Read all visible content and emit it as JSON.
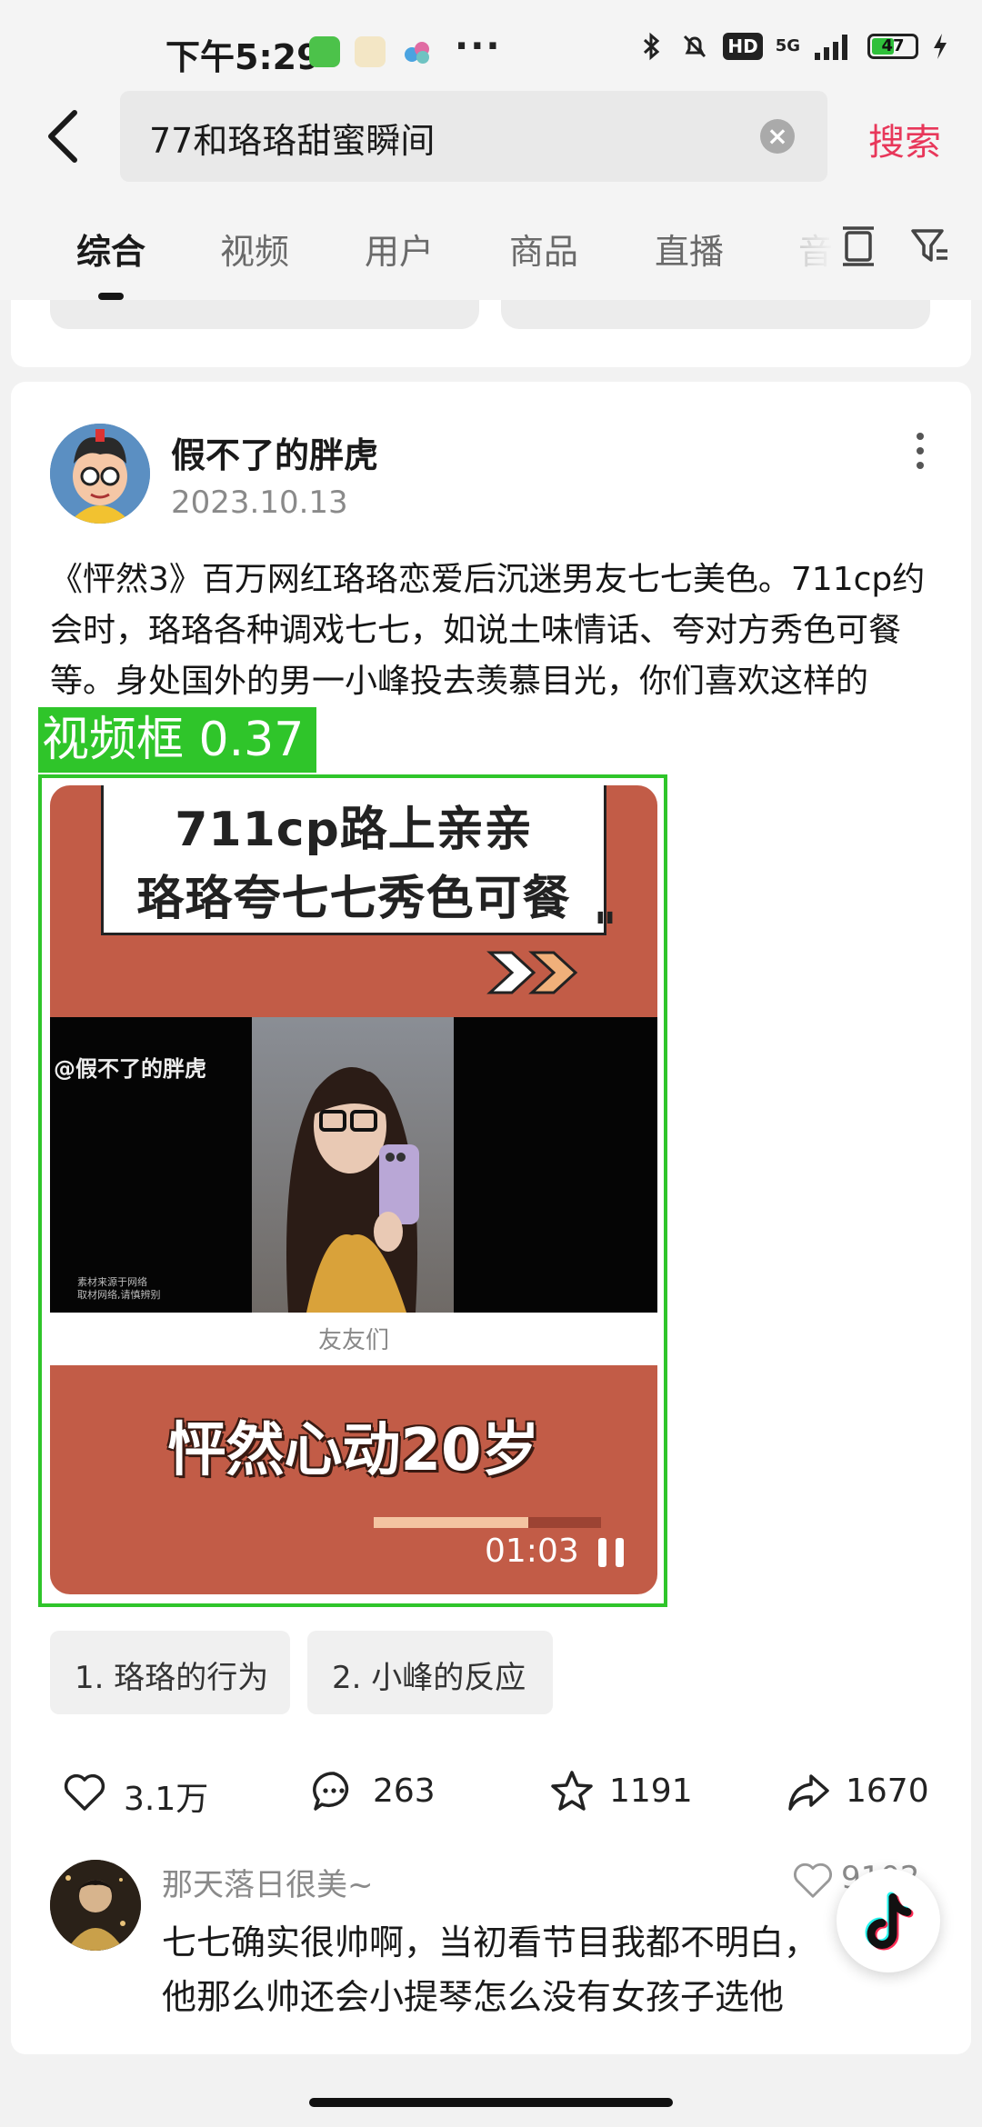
{
  "status_bar": {
    "time": "下午5:29",
    "battery": "47",
    "network": "5G",
    "hd": "HD",
    "more": "···"
  },
  "search": {
    "query": "77和珞珞甜蜜瞬间",
    "clear": "×",
    "submit": "搜索"
  },
  "tabs": [
    {
      "label": "综合",
      "active": true
    },
    {
      "label": "视频"
    },
    {
      "label": "用户"
    },
    {
      "label": "商品"
    },
    {
      "label": "直播"
    },
    {
      "label": "音"
    }
  ],
  "post": {
    "author": "假不了的胖虎",
    "date": "2023.10.13",
    "body": "《怦然3》百万网红珞珞恋爱后沉迷男友七七美色。711cp约会时，珞珞各种调戏七七，如说土味情话、夸对方秀色可餐等。身处国外的男一小峰投去羡慕目光，你们喜欢这样的711cp吗?",
    "video": {
      "title_line1": "711cp路上亲亲",
      "title_line2": "珞珞夸七七秀色可餐",
      "quote_mark": "\"",
      "arrows": "❯❯",
      "handle": "@假不了的胖虎",
      "small_note": "素材来源于网络\n取材网络,请慎辨别",
      "strip_text": "友友们",
      "caption": "怦然心动20岁",
      "time": "01:03",
      "progress": 0.68
    },
    "detection": {
      "label": "视频框 0.37"
    },
    "chips": [
      "1. 珞珞的行为",
      "2. 小峰的反应"
    ],
    "actions": {
      "likes": "3.1万",
      "comments": "263",
      "favorites": "1191",
      "shares": "1670"
    },
    "comment": {
      "user": "那天落日很美~",
      "line1": "七七确实很帅啊，当初看节目我都不明白，",
      "line2": "他那么帅还会小提琴怎么没有女孩子选他",
      "likes": "9102"
    }
  },
  "colors": {
    "accent": "#e8375a",
    "detect": "#2fc52a",
    "video_bg": "#c25c47"
  }
}
